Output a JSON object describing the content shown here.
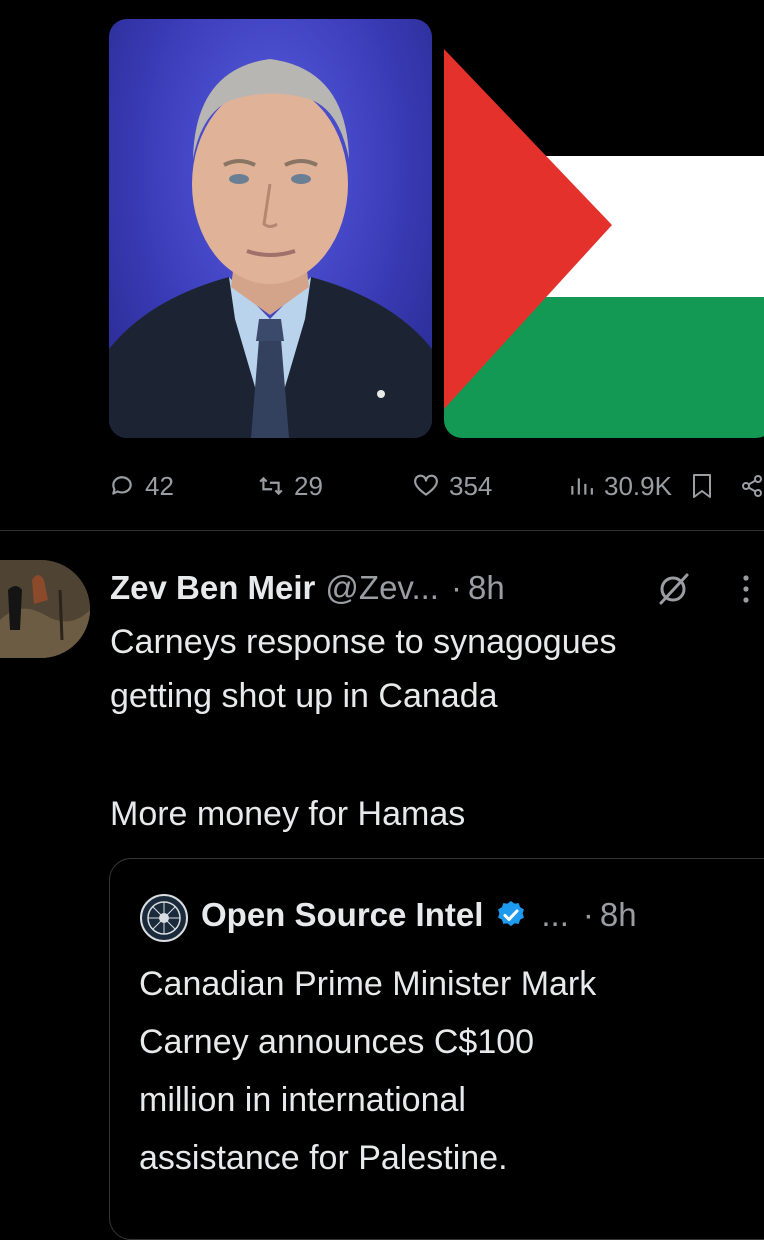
{
  "post": {
    "media": [
      {
        "name": "portrait-photo"
      },
      {
        "name": "palestinian-flag-image"
      }
    ],
    "actions": {
      "replies": "42",
      "reposts": "29",
      "likes": "354",
      "views": "30.9K"
    }
  },
  "reply": {
    "author_name": "Zev Ben Meir",
    "author_handle": "@Zev...",
    "separator": "·",
    "time": "8h",
    "text_lines": [
      "Carneys response to synagogues",
      "getting shot up in Canada",
      "",
      "More money for Hamas"
    ]
  },
  "quoted": {
    "author_name": "Open Source Intel",
    "ellipsis": "...",
    "separator": "·",
    "time": "8h",
    "text_lines": [
      "Canadian Prime Minister Mark",
      "Carney announces C$100",
      "million in international",
      "assistance for Palestine."
    ]
  },
  "colors": {
    "background": "#000000",
    "text_primary": "#e7e9ea",
    "text_secondary": "#9a9ea3",
    "verified_blue": "#1d9bf0",
    "flag_red": "#e4312b",
    "flag_white": "#ffffff",
    "flag_green": "#149954"
  },
  "icons": [
    "reply-icon",
    "repost-icon",
    "like-icon",
    "views-icon",
    "bookmark-icon",
    "share-icon",
    "grok-icon",
    "more-icon",
    "verified-badge-icon"
  ]
}
